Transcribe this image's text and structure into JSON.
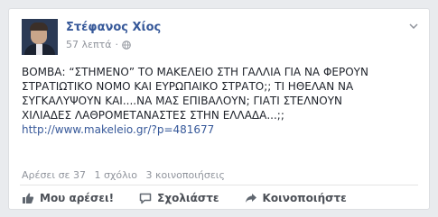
{
  "author": {
    "name": "Στέφανος Χίος",
    "time": "57 λεπτά",
    "separator": "·",
    "privacy_icon": "globe-icon"
  },
  "post": {
    "lines": [
      "ΒΟΜΒΑ: “ΣΤΗΜΕΝΟ” ΤΟ ΜΑΚΕΛΕΙΟ ΣΤΗ ΓΑΛΛΙΑ ΓΙΑ ΝΑ ΦΕΡΟΥΝ",
      "ΣΤΡΑΤΙΩΤΙΚΟ ΝΟΜΟ ΚΑΙ ΕΥΡΩΠΑΙΚΟ ΣΤΡΑΤΟ;; ΤΙ ΗΘΕΛΑΝ ΝΑ",
      "ΣΥΓΚΑΛΥΨΟΥΝ ΚΑΙ....ΝΑ ΜΑΣ ΕΠΙΒΑΛΟΥΝ; ΓΙΑΤΙ ΣΤΕΛΝΟΥΝ",
      "ΧΙΛΙΑΔΕΣ ΛΑΘΡΟΜΕΤΑΝΑΣΤΕΣ ΣΤΗΝ ΕΛΛΑΔΑ...;;"
    ],
    "link": "http://www.makeleio.gr/?p=481677"
  },
  "stats": {
    "likes": "Αρέσει σε 37",
    "comments": "1 σχόλιο",
    "shares": "3 κοινοποιήσεις"
  },
  "actions": {
    "like": "Μου αρέσει!",
    "comment": "Σχολιάστε",
    "share": "Κοινοποιήστε"
  },
  "colors": {
    "link": "#365899",
    "text": "#1d2129",
    "muted": "#90949c",
    "background": "#e9ebee"
  }
}
